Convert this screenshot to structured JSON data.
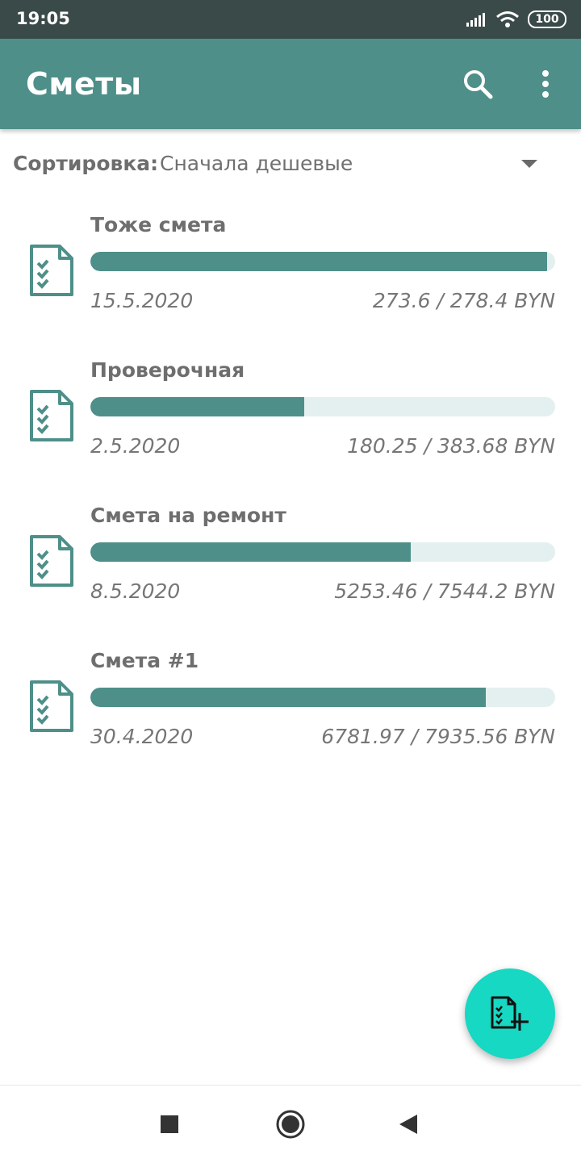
{
  "status_bar": {
    "time": "19:05",
    "battery": "100",
    "icons": [
      "signal-icon",
      "wifi-icon",
      "battery-icon"
    ]
  },
  "app_bar": {
    "title": "Сметы",
    "icons": [
      "search-icon",
      "more-vert-icon"
    ]
  },
  "sort": {
    "label": "Сортировка:",
    "value": "Сначала дешевые"
  },
  "estimates": [
    {
      "name": "Тоже смета",
      "date": "15.5.2020",
      "amount": "273.6 / 278.4 BYN",
      "progress": 0.983
    },
    {
      "name": "Проверочная",
      "date": "2.5.2020",
      "amount": "180.25 / 383.68 BYN",
      "progress": 0.46
    },
    {
      "name": "Смета на ремонт",
      "date": "8.5.2020",
      "amount": "5253.46 / 7544.2 BYN",
      "progress": 0.69
    },
    {
      "name": "Смета #1",
      "date": "30.4.2020",
      "amount": "6781.97 / 7935.56 BYN",
      "progress": 0.85
    }
  ],
  "colors": {
    "primary": "#4e8f89",
    "status_bar": "#3a4a48",
    "fab": "#16d8c3",
    "progress_track": "#e3f0ef"
  },
  "fab": {
    "icon": "add-estimate-icon"
  },
  "nav_bar": {
    "icons": [
      "recents-square-icon",
      "home-circle-icon",
      "back-triangle-icon"
    ]
  }
}
